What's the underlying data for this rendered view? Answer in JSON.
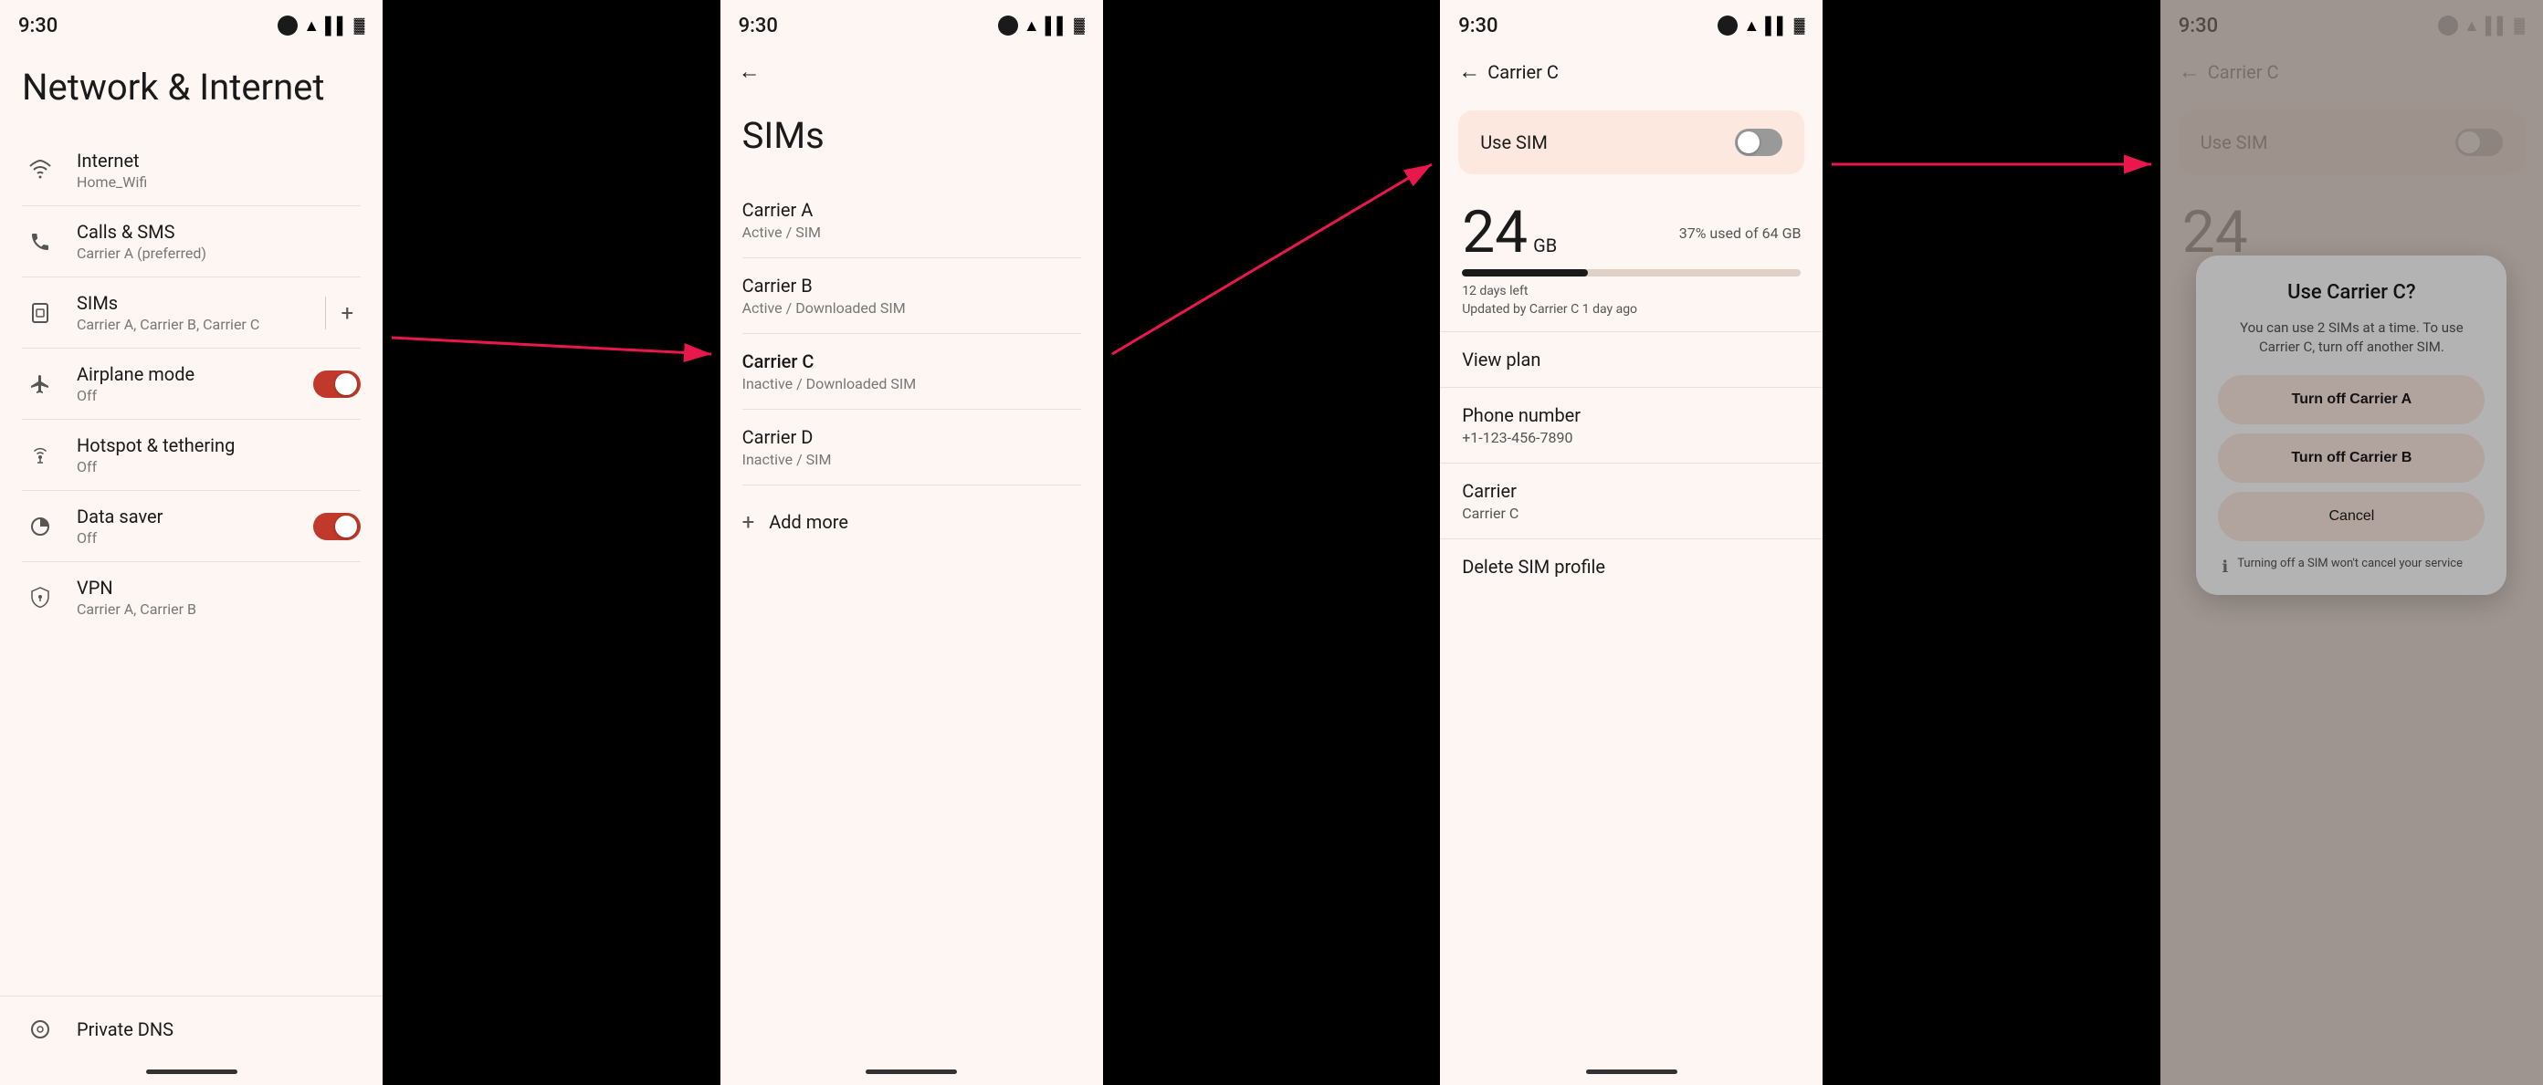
{
  "panels": {
    "panel1": {
      "time": "9:30",
      "title": "Network & Internet",
      "items": [
        {
          "id": "internet",
          "icon": "wifi",
          "label": "Internet",
          "sublabel": "Home_Wifi",
          "hasToggle": false,
          "hasDivider": false,
          "hasAdd": false
        },
        {
          "id": "calls-sms",
          "icon": "phone",
          "label": "Calls & SMS",
          "sublabel": "Carrier A (preferred)",
          "hasToggle": false,
          "hasDivider": false,
          "hasAdd": false
        },
        {
          "id": "sims",
          "icon": "sim",
          "label": "SIMs",
          "sublabel": "Carrier A, Carrier B, Carrier C",
          "hasToggle": false,
          "hasDivider": true,
          "hasAdd": true
        },
        {
          "id": "airplane",
          "icon": "airplane",
          "label": "Airplane mode",
          "sublabel": "Off",
          "hasToggle": true,
          "toggleOn": true,
          "hasDivider": false,
          "hasAdd": false
        },
        {
          "id": "hotspot",
          "icon": "hotspot",
          "label": "Hotspot & tethering",
          "sublabel": "Off",
          "hasToggle": false,
          "hasDivider": false,
          "hasAdd": false
        },
        {
          "id": "datasaver",
          "icon": "datasaver",
          "label": "Data saver",
          "sublabel": "Off",
          "hasToggle": true,
          "toggleOn": true,
          "hasDivider": false,
          "hasAdd": false
        },
        {
          "id": "vpn",
          "icon": "vpn",
          "label": "VPN",
          "sublabel": "Carrier A, Carrier B",
          "hasToggle": false,
          "hasDivider": false,
          "hasAdd": false
        }
      ],
      "privateDns": {
        "label": "Private DNS",
        "icon": "dns"
      }
    },
    "panel2": {
      "time": "9:30",
      "title": "SIMs",
      "carriers": [
        {
          "name": "Carrier A",
          "status": "Active / SIM"
        },
        {
          "name": "Carrier B",
          "status": "Active / Downloaded SIM"
        },
        {
          "name": "Carrier C",
          "status": "Inactive / Downloaded SIM",
          "highlighted": true
        },
        {
          "name": "Carrier D",
          "status": "Inactive / SIM"
        }
      ],
      "addMore": "Add more"
    },
    "panel3": {
      "time": "9:30",
      "backLabel": "Carrier C",
      "useSim": {
        "label": "Use SIM",
        "toggleOn": false
      },
      "dataUsage": {
        "amount": "24",
        "unit": "GB",
        "percentText": "37% used of 64 GB",
        "fillPercent": 37,
        "daysLeft": "12 days left",
        "updated": "Updated by Carrier C 1 day ago"
      },
      "items": [
        {
          "label": "View plan",
          "value": ""
        },
        {
          "label": "Phone number",
          "value": "+1-123-456-7890"
        },
        {
          "label": "Carrier",
          "value": "Carrier C"
        },
        {
          "label": "Delete SIM profile",
          "value": ""
        }
      ]
    },
    "panel4": {
      "time": "9:30",
      "backLabel": "Carrier C",
      "useSim": {
        "label": "Use SIM",
        "toggleOn": false
      },
      "dialog": {
        "title": "Use Carrier C?",
        "description": "You can use 2 SIMs at a time. To use Carrier C, turn off another SIM.",
        "buttons": [
          {
            "label": "Turn off Carrier A",
            "id": "turn-off-a"
          },
          {
            "label": "Turn off Carrier B",
            "id": "turn-off-b"
          },
          {
            "label": "Cancel",
            "id": "cancel",
            "isCancel": true
          }
        ],
        "footerText": "Turning off a SIM won't cancel your service"
      }
    }
  },
  "icons": {
    "wifi": "▲",
    "phone": "✆",
    "sim": "▦",
    "airplane": "✈",
    "hotspot": "⊙",
    "datasaver": "◑",
    "vpn": "⚿",
    "dns": "◈",
    "info": "ℹ"
  }
}
